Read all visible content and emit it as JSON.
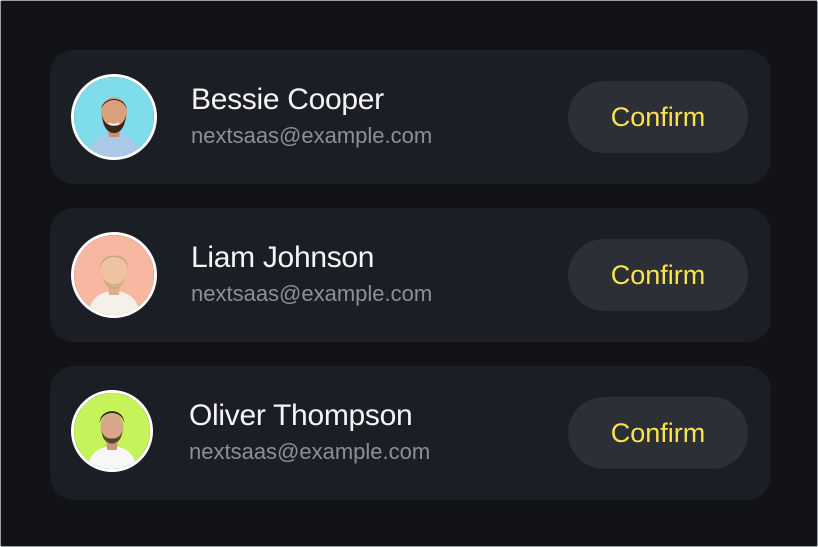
{
  "contacts": [
    {
      "name": "Bessie Cooper",
      "email": "nextsaas@example.com",
      "action_label": "Confirm",
      "avatar_bg": "#7fdcea",
      "avatar_icon": "man-beard-avatar"
    },
    {
      "name": "Liam Johnson",
      "email": "nextsaas@example.com",
      "action_label": "Confirm",
      "avatar_bg": "#f7b7a0",
      "avatar_icon": "man-light-hair-avatar"
    },
    {
      "name": "Oliver Thompson",
      "email": "nextsaas@example.com",
      "action_label": "Confirm",
      "avatar_bg": "#c6f25a",
      "avatar_icon": "man-dark-hair-avatar"
    }
  ],
  "colors": {
    "page_background": "#111316",
    "card_background": "#1b1e24",
    "button_background": "#2c2f36",
    "accent": "#f7e34a",
    "name_text": "#f5f5f7",
    "email_text": "#8c9096"
  }
}
